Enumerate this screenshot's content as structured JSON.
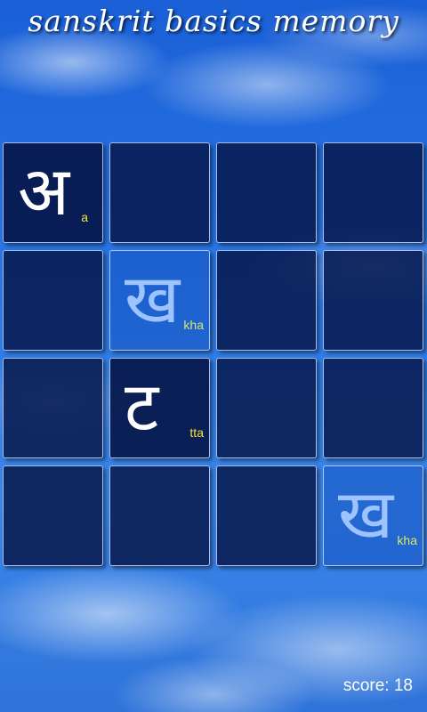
{
  "title": "sanskrit basics memory",
  "cards": [
    {
      "glyph": "अ",
      "translit": "a",
      "state": "matched"
    },
    {
      "glyph": "",
      "translit": "",
      "state": "hidden"
    },
    {
      "glyph": "",
      "translit": "",
      "state": "hidden"
    },
    {
      "glyph": "",
      "translit": "",
      "state": "hidden"
    },
    {
      "glyph": "",
      "translit": "",
      "state": "hidden"
    },
    {
      "glyph": "ख",
      "translit": "kha",
      "state": "flipped"
    },
    {
      "glyph": "",
      "translit": "",
      "state": "hidden"
    },
    {
      "glyph": "",
      "translit": "",
      "state": "hidden"
    },
    {
      "glyph": "",
      "translit": "",
      "state": "hidden"
    },
    {
      "glyph": "ट",
      "translit": "tta",
      "state": "matched"
    },
    {
      "glyph": "",
      "translit": "",
      "state": "hidden"
    },
    {
      "glyph": "",
      "translit": "",
      "state": "hidden"
    },
    {
      "glyph": "",
      "translit": "",
      "state": "hidden"
    },
    {
      "glyph": "",
      "translit": "",
      "state": "hidden"
    },
    {
      "glyph": "",
      "translit": "",
      "state": "hidden"
    },
    {
      "glyph": "ख",
      "translit": "kha",
      "state": "flipped"
    }
  ],
  "score_text": "score: 18"
}
